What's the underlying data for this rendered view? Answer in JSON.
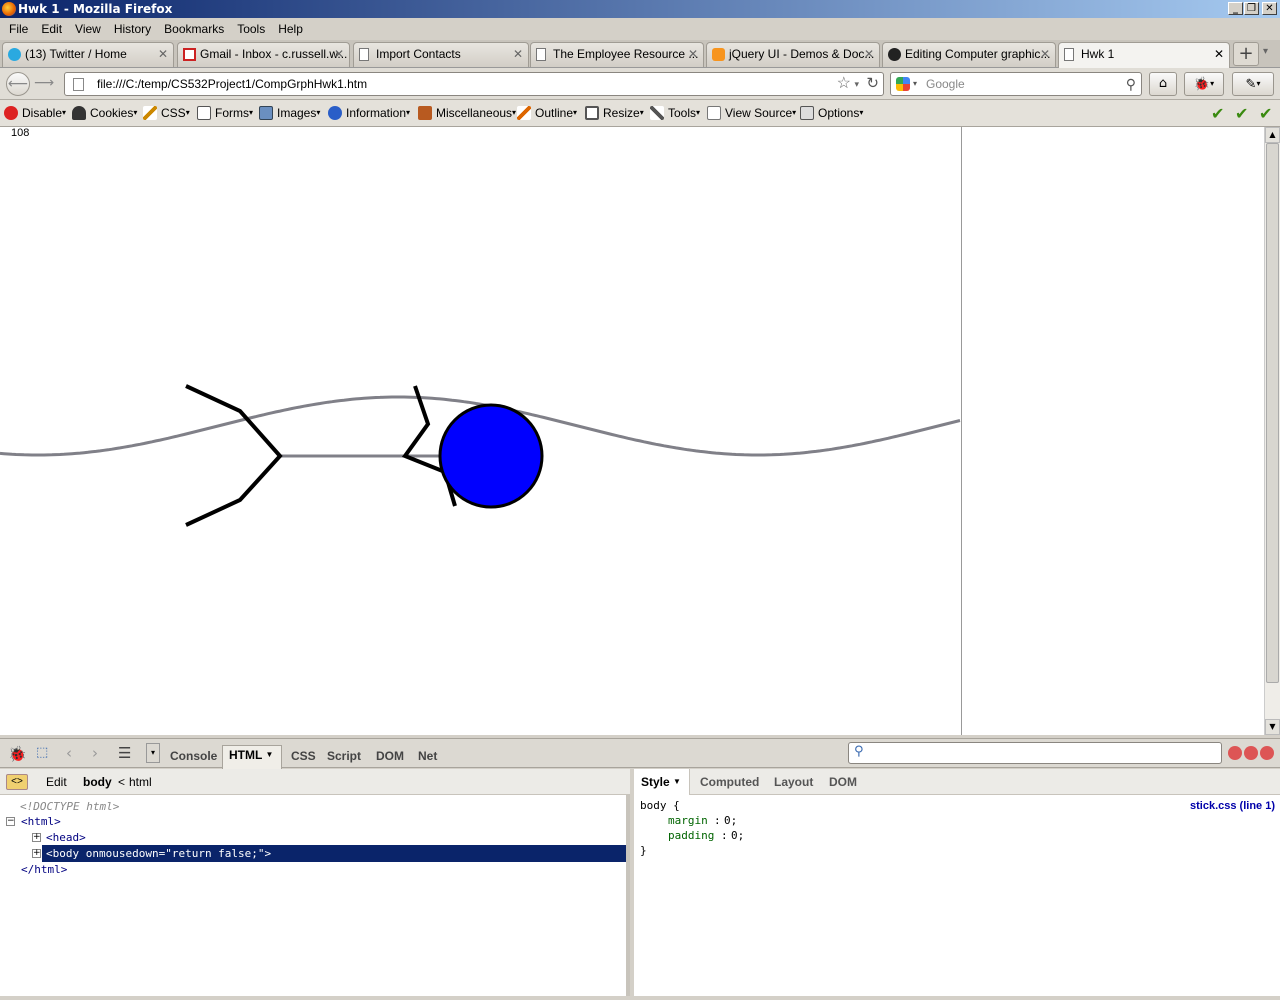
{
  "window": {
    "title": "Hwk 1 - Mozilla Firefox"
  },
  "menu": [
    "File",
    "Edit",
    "View",
    "History",
    "Bookmarks",
    "Tools",
    "Help"
  ],
  "tabs": [
    {
      "label": "(13) Twitter / Home",
      "icon": "twitter-icon"
    },
    {
      "label": "Gmail - Inbox - c.russell.w...",
      "icon": "gmail-icon"
    },
    {
      "label": "Import Contacts",
      "icon": "page-icon"
    },
    {
      "label": "The Employee Resource ...",
      "icon": "page-icon"
    },
    {
      "label": "jQuery UI - Demos & Doc...",
      "icon": "jquery-icon"
    },
    {
      "label": "Editing Computer graphic...",
      "icon": "github-icon"
    },
    {
      "label": "Hwk 1",
      "icon": "page-icon",
      "active": true
    }
  ],
  "nav": {
    "url": "file:///C:/temp/CS532Project1/CompGrphHwk1.htm",
    "search_placeholder": "Google"
  },
  "webdev": [
    "Disable",
    "Cookies",
    "CSS",
    "Forms",
    "Images",
    "Information",
    "Miscellaneous",
    "Outline",
    "Resize",
    "Tools",
    "View Source",
    "Options"
  ],
  "page": {
    "counter": "108"
  },
  "firebug": {
    "tabs": [
      "Console",
      "HTML",
      "CSS",
      "Script",
      "DOM",
      "Net"
    ],
    "active_tab": "HTML",
    "left": {
      "edit": "Edit",
      "breadcrumb_body": "body",
      "breadcrumb_sep": "<",
      "breadcrumb_html": "html",
      "doctype": "<!DOCTYPE html>",
      "html_open": "<html>",
      "head": "<head>",
      "body": "<body onmousedown=\"return false;\">",
      "html_close": "</html>"
    },
    "right": {
      "tabs": [
        "Style",
        "Computed",
        "Layout",
        "DOM"
      ],
      "selector": "body {",
      "prop1_name": "margin",
      "prop1_value": "0;",
      "prop2_name": "padding",
      "prop2_value": "0;",
      "close": "}",
      "source": "stick.css (line 1)"
    }
  },
  "colors": {
    "ball": "#0000ff",
    "wave": "#808088",
    "sticks": "#000000",
    "selection": "#0a246a"
  }
}
